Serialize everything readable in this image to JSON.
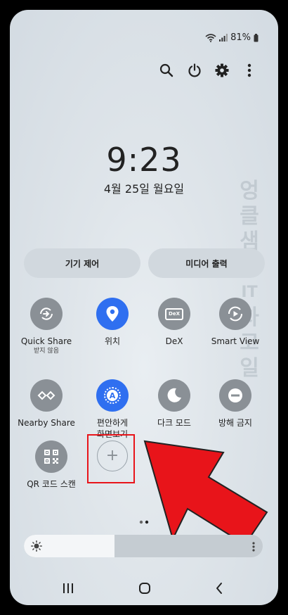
{
  "status": {
    "battery": "81%"
  },
  "top_icons": [
    "search-icon",
    "power-icon",
    "gear-icon",
    "more-vertical-icon"
  ],
  "clock": {
    "time": "9:23",
    "date": "4월 25일 월요일"
  },
  "pills": {
    "device_control": "기기 제어",
    "media_output": "미디어 출력"
  },
  "tiles": {
    "quick_share": {
      "label": "Quick Share",
      "sub": "받지 않음"
    },
    "location": {
      "label": "위치"
    },
    "dex": {
      "label": "DeX",
      "glyph": "DeX"
    },
    "smart_view": {
      "label": "Smart View"
    },
    "nearby_share": {
      "label": "Nearby Share"
    },
    "easy_mode": {
      "label": "편안하게\n화면보기",
      "line1": "편안하게",
      "line2": "화면보기",
      "glyph": "A"
    },
    "dark_mode": {
      "label": "다크 모드"
    },
    "dnd": {
      "label": "방해 금지"
    },
    "qr_scan": {
      "label": "QR 코드 스캔"
    }
  },
  "add_button": {
    "glyph": "+"
  },
  "brightness": {
    "level": 0.38
  },
  "watermark": {
    "lines": [
      "엉",
      "클",
      "샘",
      "의",
      "IT",
      "차",
      "고",
      "일"
    ]
  },
  "colors": {
    "active_tile": "#2f6ff0",
    "inactive_tile": "#8a9096",
    "highlight": "#e8141a"
  }
}
